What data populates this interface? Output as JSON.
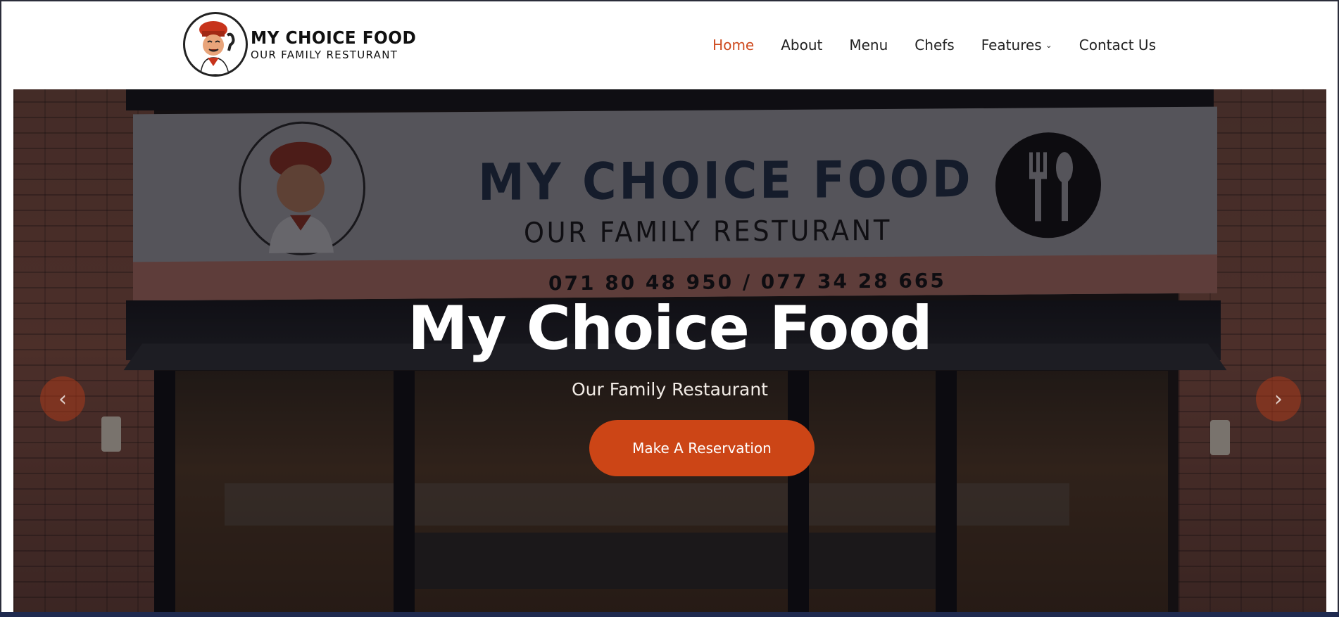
{
  "header": {
    "logo_title": "MY CHOICE FOOD",
    "logo_subtitle": "OUR FAMILY RESTURANT"
  },
  "nav": {
    "items": [
      {
        "label": "Home",
        "active": true
      },
      {
        "label": "About"
      },
      {
        "label": "Menu"
      },
      {
        "label": "Chefs"
      },
      {
        "label": "Features",
        "has_dropdown": true
      },
      {
        "label": "Contact Us"
      }
    ]
  },
  "hero": {
    "banner_title": "MY CHOICE FOOD",
    "banner_subtitle": "OUR FAMILY RESTURANT",
    "banner_phone": "071 80 48 950 / 077 34 28 665",
    "title": "My Choice Food",
    "subtitle": "Our Family Restaurant",
    "cta_label": "Make A Reservation",
    "prev_icon": "chevron-left-icon",
    "next_icon": "chevron-right-icon"
  },
  "colors": {
    "accent": "#ce4a1e",
    "cta": "#cc4516",
    "text": "#222222"
  }
}
